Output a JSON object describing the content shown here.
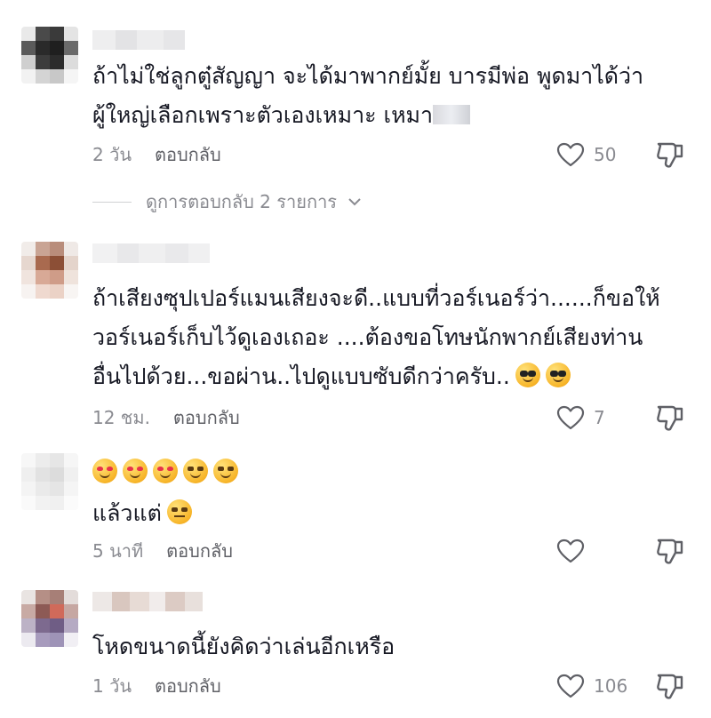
{
  "comments": [
    {
      "text": "ถ้าไม่ใช่ลูกตู๋สัญญา จะได้มาพากย์มั้ย บารมีพ่อ พูดมาได้ว่า\nผู้ใหญ่เลือกเพราะตัวเองเหมาะ เหมา",
      "time": "2 วัน",
      "reply_label": "ตอบกลับ",
      "likes": "50",
      "view_replies": "ดูการตอบกลับ 2 รายการ"
    },
    {
      "text": "ถ้าเสียงซุปเปอร์แมนเสียงจะดี..แบบที่วอร์เนอร์ว่า......ก็ขอให้\nวอร์เนอร์เก็บไว้ดูเองเถอะ ....ต้องขอโทษนักพากย์เสียงท่าน\nอื่นไปด้วย...ขอผ่าน..ไปดูแบบซับดีกว่าครับ..",
      "time": "12 ชม.",
      "reply_label": "ตอบกลับ",
      "likes": "7"
    },
    {
      "text": "แล้วแต่",
      "time": "5 นาที",
      "reply_label": "ตอบกลับ",
      "likes": ""
    },
    {
      "text": "โหดขนาดนี้ยังคิดว่าเล่นอีกเหรือ",
      "time": "1 วัน",
      "reply_label": "ตอบกลับ",
      "likes": "106"
    }
  ],
  "icons": {
    "like": "heart-outline-icon",
    "dislike": "thumbs-down-outline-icon",
    "expand": "chevron-down-icon"
  },
  "colors": {
    "text": "#161823",
    "muted": "#8a8b91"
  }
}
